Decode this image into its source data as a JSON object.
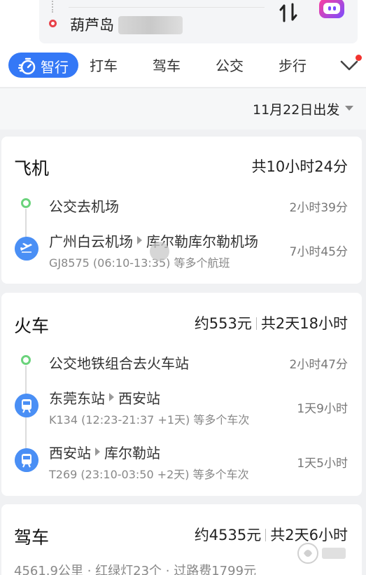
{
  "route": {
    "destination": "葫芦岛"
  },
  "tabs": {
    "active": "智行",
    "items": [
      "打车",
      "驾车",
      "公交",
      "步行"
    ]
  },
  "date_label": "11月22日出发",
  "flight": {
    "title": "飞机",
    "summary": "共10小时24分",
    "segments": [
      {
        "title": "公交去机场",
        "duration": "2小时39分"
      },
      {
        "from": "广州白云机场",
        "to": "库尔勒库尔勒机场",
        "detail": "GJ8575 (06:10-13:35) 等多个航班",
        "duration": "7小时45分"
      }
    ]
  },
  "train": {
    "title": "火车",
    "price": "约553元",
    "total": "共2天18小时",
    "segments": [
      {
        "title": "公交地铁组合去火车站",
        "duration": "2小时47分"
      },
      {
        "from": "东莞东站",
        "to": "西安站",
        "detail": "K134 (12:23-21:37 +1天) 等多个车次",
        "duration": "1天9小时"
      },
      {
        "from": "西安站",
        "to": "库尔勒站",
        "detail": "T269 (23:10-03:50 +2天) 等多个车次",
        "duration": "1天5小时"
      }
    ]
  },
  "drive": {
    "title": "驾车",
    "price": "约4535元",
    "total": "共2天6小时",
    "distance": "4561.9公里",
    "lights": "红绿灯23个",
    "toll": "过路费1799元"
  },
  "colors": {
    "accent": "#3478f6",
    "dest_marker": "#e8424a",
    "walk_marker": "#6bd37c"
  }
}
